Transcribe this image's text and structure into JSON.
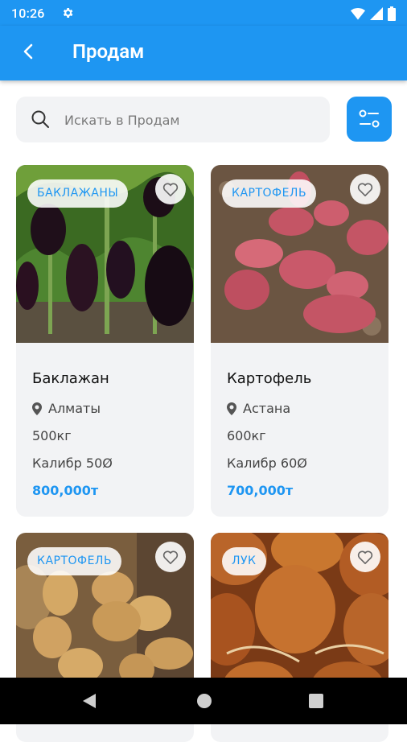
{
  "status": {
    "time": "10:26"
  },
  "appbar": {
    "title": "Продам"
  },
  "search": {
    "placeholder": "Искать в Продам"
  },
  "colors": {
    "accent": "#1e96f2"
  },
  "cards": [
    {
      "tag": "БАКЛАЖАНЫ",
      "name": "Баклажан",
      "city": "Алматы",
      "qty": "500кг",
      "caliber": "Калибр 50Ø",
      "price": "800,000т"
    },
    {
      "tag": "КАРТОФЕЛЬ",
      "name": "Картофель",
      "city": "Астана",
      "qty": "600кг",
      "caliber": "Калибр 60Ø",
      "price": "700,000т"
    },
    {
      "tag": "КАРТОФЕЛЬ"
    },
    {
      "tag": "ЛУК"
    }
  ]
}
